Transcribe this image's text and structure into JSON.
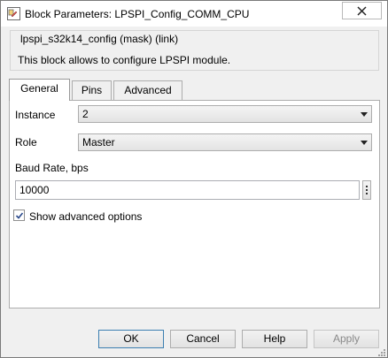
{
  "window": {
    "title": "Block Parameters: LPSPI_Config_COMM_CPU"
  },
  "mask": {
    "group_title": "lpspi_s32k14_config (mask) (link)",
    "description": "This block allows to configure LPSPI module."
  },
  "tabs": [
    {
      "label": "General",
      "active": true
    },
    {
      "label": "Pins",
      "active": false
    },
    {
      "label": "Advanced",
      "active": false
    }
  ],
  "general": {
    "instance_label": "Instance",
    "instance_value": "2",
    "role_label": "Role",
    "role_value": "Master",
    "baud_label": "Baud Rate, bps",
    "baud_value": "10000",
    "show_advanced_label": "Show advanced options",
    "show_advanced_checked": true
  },
  "buttons": {
    "ok": "OK",
    "cancel": "Cancel",
    "help": "Help",
    "apply": "Apply"
  },
  "colors": {
    "dialog_bg": "#f0f0f0",
    "panel_bg": "#ffffff",
    "default_button_border": "#3c7fb1",
    "disabled_text": "#8a8a8a"
  }
}
